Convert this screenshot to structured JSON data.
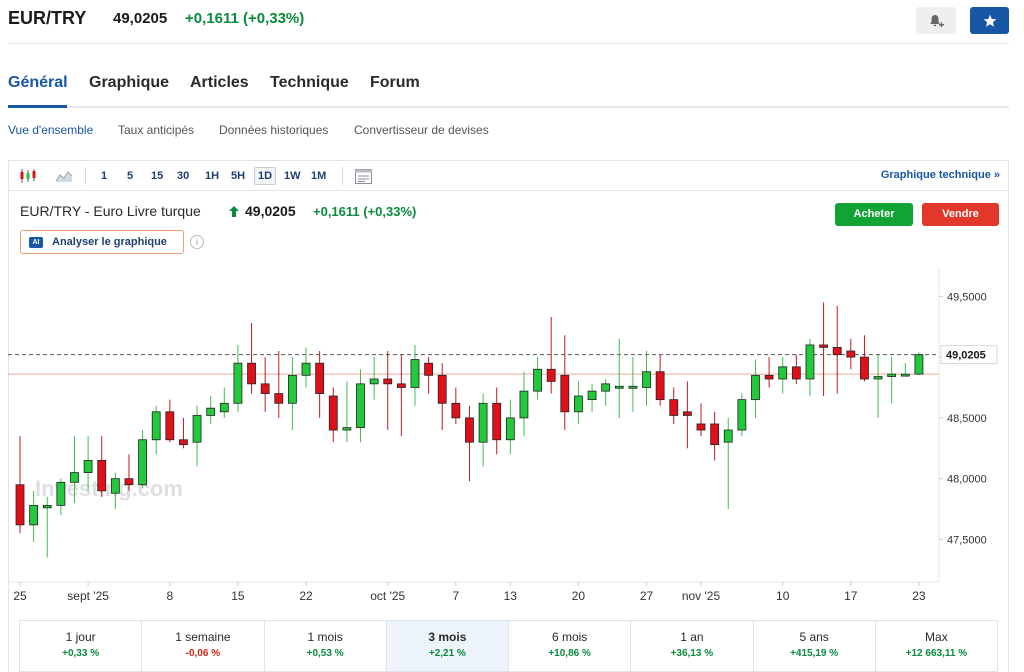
{
  "header": {
    "pair": "EUR/TRY",
    "price": "49,0205",
    "change": "+0,1611 (+0,33%)",
    "alert_icon": "bell-plus-icon",
    "watchlist_icon": "star-icon"
  },
  "tabs": [
    {
      "label": "Général",
      "active": true
    },
    {
      "label": "Graphique",
      "active": false
    },
    {
      "label": "Articles",
      "active": false
    },
    {
      "label": "Technique",
      "active": false
    },
    {
      "label": "Forum",
      "active": false
    }
  ],
  "subtabs": [
    {
      "label": "Vue d'ensemble",
      "active": true
    },
    {
      "label": "Taux anticipés",
      "active": false
    },
    {
      "label": "Données historiques",
      "active": false
    },
    {
      "label": "Convertisseur de devises",
      "active": false
    }
  ],
  "toolbar": {
    "timeframes": [
      "1",
      "5",
      "15",
      "30",
      "1H",
      "5H",
      "1D",
      "1W",
      "1M"
    ],
    "active_timeframe": "1D",
    "tech_link": "Graphique technique »",
    "icons": [
      "candlestick-icon",
      "area-chart-icon",
      "table-icon"
    ]
  },
  "chart_header": {
    "title": "EUR/TRY - Euro Livre turque",
    "price": "49,0205",
    "change": "+0,1611 (+0,33%)",
    "buy_label": "Acheter",
    "sell_label": "Vendre",
    "ai_badge": "AI",
    "ai_label": "Analyser le graphique",
    "watermark": "Investing.com"
  },
  "chart_data": {
    "type": "candlestick",
    "title": "EUR/TRY - Euro Livre turque",
    "ylim": [
      47.15,
      49.7
    ],
    "yticks": [
      {
        "value": 47.5,
        "label": "47,5000"
      },
      {
        "value": 48.0,
        "label": "48,0000"
      },
      {
        "value": 48.5,
        "label": "48,5000"
      },
      {
        "value": 49.0,
        "label": "49,0000"
      },
      {
        "value": 49.5,
        "label": "49,5000"
      }
    ],
    "current_price": {
      "value": 49.0205,
      "label": "49,0205"
    },
    "red_reference_level": 48.86,
    "xticks": [
      {
        "index": 0,
        "label": "25"
      },
      {
        "index": 5,
        "label": "sept '25"
      },
      {
        "index": 11,
        "label": "8"
      },
      {
        "index": 16,
        "label": "15"
      },
      {
        "index": 21,
        "label": "22"
      },
      {
        "index": 27,
        "label": "oct '25"
      },
      {
        "index": 32,
        "label": "7"
      },
      {
        "index": 36,
        "label": "13"
      },
      {
        "index": 41,
        "label": "20"
      },
      {
        "index": 46,
        "label": "27"
      },
      {
        "index": 50,
        "label": "nov '25"
      },
      {
        "index": 56,
        "label": "10"
      },
      {
        "index": 61,
        "label": "17"
      },
      {
        "index": 66,
        "label": "23"
      }
    ],
    "candles": [
      {
        "o": 47.95,
        "h": 48.35,
        "l": 47.55,
        "c": 47.62
      },
      {
        "o": 47.62,
        "h": 47.9,
        "l": 47.48,
        "c": 47.78
      },
      {
        "o": 47.76,
        "h": 47.85,
        "l": 47.35,
        "c": 47.78
      },
      {
        "o": 47.78,
        "h": 48.0,
        "l": 47.7,
        "c": 47.97
      },
      {
        "o": 47.97,
        "h": 48.35,
        "l": 47.8,
        "c": 48.05
      },
      {
        "o": 48.05,
        "h": 48.35,
        "l": 47.9,
        "c": 48.15
      },
      {
        "o": 48.15,
        "h": 48.35,
        "l": 47.85,
        "c": 47.9
      },
      {
        "o": 47.88,
        "h": 48.05,
        "l": 47.75,
        "c": 48.0
      },
      {
        "o": 48.0,
        "h": 48.2,
        "l": 47.9,
        "c": 47.95
      },
      {
        "o": 47.95,
        "h": 48.4,
        "l": 47.92,
        "c": 48.32
      },
      {
        "o": 48.32,
        "h": 48.6,
        "l": 48.2,
        "c": 48.55
      },
      {
        "o": 48.55,
        "h": 48.65,
        "l": 48.3,
        "c": 48.32
      },
      {
        "o": 48.32,
        "h": 48.5,
        "l": 48.25,
        "c": 48.28
      },
      {
        "o": 48.3,
        "h": 48.6,
        "l": 48.1,
        "c": 48.52
      },
      {
        "o": 48.52,
        "h": 48.68,
        "l": 48.45,
        "c": 48.58
      },
      {
        "o": 48.55,
        "h": 48.75,
        "l": 48.5,
        "c": 48.62
      },
      {
        "o": 48.62,
        "h": 49.1,
        "l": 48.55,
        "c": 48.95
      },
      {
        "o": 48.95,
        "h": 49.28,
        "l": 48.7,
        "c": 48.78
      },
      {
        "o": 48.78,
        "h": 49.0,
        "l": 48.55,
        "c": 48.7
      },
      {
        "o": 48.7,
        "h": 49.05,
        "l": 48.5,
        "c": 48.62
      },
      {
        "o": 48.62,
        "h": 49.0,
        "l": 48.4,
        "c": 48.85
      },
      {
        "o": 48.85,
        "h": 49.08,
        "l": 48.75,
        "c": 48.95
      },
      {
        "o": 48.95,
        "h": 49.05,
        "l": 48.5,
        "c": 48.7
      },
      {
        "o": 48.68,
        "h": 48.75,
        "l": 48.3,
        "c": 48.4
      },
      {
        "o": 48.4,
        "h": 48.8,
        "l": 48.3,
        "c": 48.42
      },
      {
        "o": 48.42,
        "h": 48.9,
        "l": 48.3,
        "c": 48.78
      },
      {
        "o": 48.78,
        "h": 49.0,
        "l": 48.65,
        "c": 48.82
      },
      {
        "o": 48.82,
        "h": 49.05,
        "l": 48.4,
        "c": 48.78
      },
      {
        "o": 48.78,
        "h": 49.02,
        "l": 48.35,
        "c": 48.75
      },
      {
        "o": 48.75,
        "h": 49.1,
        "l": 48.6,
        "c": 48.98
      },
      {
        "o": 48.95,
        "h": 49.0,
        "l": 48.7,
        "c": 48.85
      },
      {
        "o": 48.85,
        "h": 48.95,
        "l": 48.4,
        "c": 48.62
      },
      {
        "o": 48.62,
        "h": 48.75,
        "l": 48.45,
        "c": 48.5
      },
      {
        "o": 48.5,
        "h": 48.6,
        "l": 47.98,
        "c": 48.3
      },
      {
        "o": 48.3,
        "h": 48.7,
        "l": 48.1,
        "c": 48.62
      },
      {
        "o": 48.62,
        "h": 48.75,
        "l": 48.2,
        "c": 48.32
      },
      {
        "o": 48.32,
        "h": 48.65,
        "l": 48.2,
        "c": 48.5
      },
      {
        "o": 48.5,
        "h": 48.88,
        "l": 48.35,
        "c": 48.72
      },
      {
        "o": 48.72,
        "h": 49.0,
        "l": 48.65,
        "c": 48.9
      },
      {
        "o": 48.9,
        "h": 49.33,
        "l": 48.7,
        "c": 48.8
      },
      {
        "o": 48.85,
        "h": 49.18,
        "l": 48.4,
        "c": 48.55
      },
      {
        "o": 48.55,
        "h": 48.8,
        "l": 48.45,
        "c": 48.68
      },
      {
        "o": 48.65,
        "h": 48.78,
        "l": 48.55,
        "c": 48.72
      },
      {
        "o": 48.72,
        "h": 48.82,
        "l": 48.6,
        "c": 48.78
      },
      {
        "o": 48.76,
        "h": 49.15,
        "l": 48.5,
        "c": 48.76
      },
      {
        "o": 48.76,
        "h": 49.0,
        "l": 48.55,
        "c": 48.76
      },
      {
        "o": 48.75,
        "h": 49.05,
        "l": 48.6,
        "c": 48.88
      },
      {
        "o": 48.88,
        "h": 49.02,
        "l": 48.6,
        "c": 48.65
      },
      {
        "o": 48.65,
        "h": 48.75,
        "l": 48.45,
        "c": 48.52
      },
      {
        "o": 48.55,
        "h": 48.8,
        "l": 48.25,
        "c": 48.52
      },
      {
        "o": 48.45,
        "h": 48.62,
        "l": 48.35,
        "c": 48.4
      },
      {
        "o": 48.45,
        "h": 48.55,
        "l": 48.15,
        "c": 48.28
      },
      {
        "o": 48.3,
        "h": 48.5,
        "l": 47.75,
        "c": 48.4
      },
      {
        "o": 48.4,
        "h": 48.7,
        "l": 48.35,
        "c": 48.65
      },
      {
        "o": 48.65,
        "h": 48.98,
        "l": 48.5,
        "c": 48.85
      },
      {
        "o": 48.85,
        "h": 49.0,
        "l": 48.75,
        "c": 48.82
      },
      {
        "o": 48.82,
        "h": 49.0,
        "l": 48.7,
        "c": 48.92
      },
      {
        "o": 48.92,
        "h": 49.02,
        "l": 48.78,
        "c": 48.82
      },
      {
        "o": 48.82,
        "h": 49.15,
        "l": 48.68,
        "c": 49.1
      },
      {
        "o": 49.1,
        "h": 49.45,
        "l": 48.68,
        "c": 49.08
      },
      {
        "o": 49.08,
        "h": 49.42,
        "l": 48.7,
        "c": 49.02
      },
      {
        "o": 49.05,
        "h": 49.15,
        "l": 48.9,
        "c": 49.0
      },
      {
        "o": 49.0,
        "h": 49.18,
        "l": 48.8,
        "c": 48.82
      },
      {
        "o": 48.82,
        "h": 49.02,
        "l": 48.5,
        "c": 48.84
      },
      {
        "o": 48.84,
        "h": 49.0,
        "l": 48.62,
        "c": 48.86
      },
      {
        "o": 48.86,
        "h": 48.95,
        "l": 48.84,
        "c": 48.86
      },
      {
        "o": 48.86,
        "h": 49.04,
        "l": 48.85,
        "c": 49.02
      }
    ],
    "grid": false
  },
  "performance": [
    {
      "label": "1 jour",
      "value": "+0,33 %",
      "dir": "up",
      "active": false
    },
    {
      "label": "1 semaine",
      "value": "-0,06 %",
      "dir": "down",
      "active": false
    },
    {
      "label": "1 mois",
      "value": "+0,53 %",
      "dir": "up",
      "active": false
    },
    {
      "label": "3 mois",
      "value": "+2,21 %",
      "dir": "up",
      "active": true
    },
    {
      "label": "6 mois",
      "value": "+10,86 %",
      "dir": "up",
      "active": false
    },
    {
      "label": "1 an",
      "value": "+36,13 %",
      "dir": "up",
      "active": false
    },
    {
      "label": "5 ans",
      "value": "+415,19 %",
      "dir": "up",
      "active": false
    },
    {
      "label": "Max",
      "value": "+12 663,11 %",
      "dir": "up",
      "active": false
    }
  ],
  "colors": {
    "accent": "#1856a6",
    "up": "#22c93a",
    "down": "#e0101a",
    "positive_text": "#0a8a3c",
    "negative_text": "#d0281c"
  }
}
